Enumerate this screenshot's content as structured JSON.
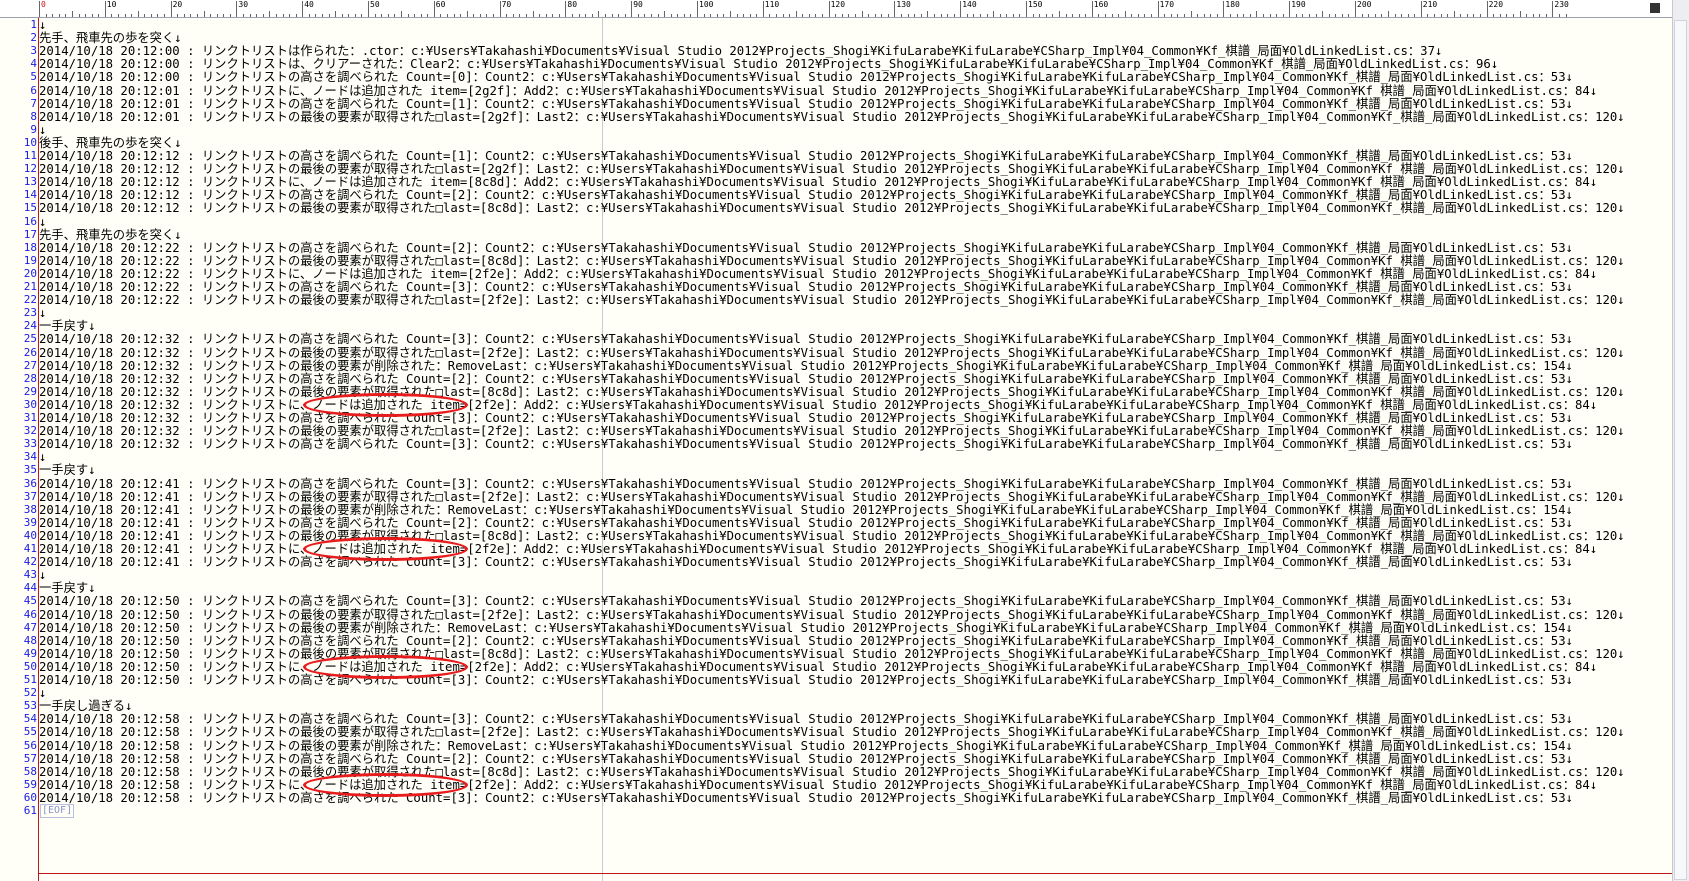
{
  "ruler_end_icon": "ruler-end-marker-icon",
  "ruler_labels": [
    "0",
    "10",
    "20",
    "30",
    "40",
    "50",
    "60",
    "70",
    "80",
    "90",
    "100",
    "110",
    "120",
    "130",
    "140",
    "150",
    "160",
    "170",
    "180",
    "190",
    "200",
    "210",
    "220",
    "230"
  ],
  "eof_marker": "[EOF]",
  "highlight_color": "#e81c1c",
  "line_number_color": "#1a1ae6",
  "highlighted_lines": [
    30,
    41,
    50,
    59
  ],
  "lines": [
    "↓",
    "先手、飛車先の歩を突く↓",
    "2014/10/18 20:12:00 : リンクトリストは作られた：.ctor：c:¥Users¥Takahashi¥Documents¥Visual Studio 2012¥Projects_Shogi¥KifuLarabe¥KifuLarabe¥CSharp_Impl¥04_Common¥Kf_棋譜_局面¥OldLinkedList.cs：37↓",
    "2014/10/18 20:12:00 : リンクトリストは、クリアーされた：Clear2：c:¥Users¥Takahashi¥Documents¥Visual Studio 2012¥Projects_Shogi¥KifuLarabe¥KifuLarabe¥CSharp_Impl¥04_Common¥Kf_棋譜_局面¥OldLinkedList.cs：96↓",
    "2014/10/18 20:12:00 : リンクトリストの高さを調べられた Count=[0]：Count2：c:¥Users¥Takahashi¥Documents¥Visual Studio 2012¥Projects_Shogi¥KifuLarabe¥KifuLarabe¥CSharp_Impl¥04_Common¥Kf_棋譜_局面¥OldLinkedList.cs：53↓",
    "2014/10/18 20:12:01 : リンクトリストに、ノードは追加された item=[2g2f]：Add2：c:¥Users¥Takahashi¥Documents¥Visual Studio 2012¥Projects_Shogi¥KifuLarabe¥KifuLarabe¥CSharp_Impl¥04_Common¥Kf_棋譜_局面¥OldLinkedList.cs：84↓",
    "2014/10/18 20:12:01 : リンクトリストの高さを調べられた Count=[1]：Count2：c:¥Users¥Takahashi¥Documents¥Visual Studio 2012¥Projects_Shogi¥KifuLarabe¥KifuLarabe¥CSharp_Impl¥04_Common¥Kf_棋譜_局面¥OldLinkedList.cs：53↓",
    "2014/10/18 20:12:01 : リンクトリストの最後の要素が取得された□last=[2g2f]：Last2：c:¥Users¥Takahashi¥Documents¥Visual Studio 2012¥Projects_Shogi¥KifuLarabe¥KifuLarabe¥CSharp_Impl¥04_Common¥Kf_棋譜_局面¥OldLinkedList.cs：120↓",
    "↓",
    "後手、飛車先の歩を突く↓",
    "2014/10/18 20:12:12 : リンクトリストの高さを調べられた Count=[1]：Count2：c:¥Users¥Takahashi¥Documents¥Visual Studio 2012¥Projects_Shogi¥KifuLarabe¥KifuLarabe¥CSharp_Impl¥04_Common¥Kf_棋譜_局面¥OldLinkedList.cs：53↓",
    "2014/10/18 20:12:12 : リンクトリストの最後の要素が取得された□last=[2g2f]：Last2：c:¥Users¥Takahashi¥Documents¥Visual Studio 2012¥Projects_Shogi¥KifuLarabe¥KifuLarabe¥CSharp_Impl¥04_Common¥Kf_棋譜_局面¥OldLinkedList.cs：120↓",
    "2014/10/18 20:12:12 : リンクトリストに、ノードは追加された item=[8c8d]：Add2：c:¥Users¥Takahashi¥Documents¥Visual Studio 2012¥Projects_Shogi¥KifuLarabe¥KifuLarabe¥CSharp_Impl¥04_Common¥Kf_棋譜_局面¥OldLinkedList.cs：84↓",
    "2014/10/18 20:12:12 : リンクトリストの高さを調べられた Count=[2]：Count2：c:¥Users¥Takahashi¥Documents¥Visual Studio 2012¥Projects_Shogi¥KifuLarabe¥KifuLarabe¥CSharp_Impl¥04_Common¥Kf_棋譜_局面¥OldLinkedList.cs：53↓",
    "2014/10/18 20:12:12 : リンクトリストの最後の要素が取得された□last=[8c8d]：Last2：c:¥Users¥Takahashi¥Documents¥Visual Studio 2012¥Projects_Shogi¥KifuLarabe¥KifuLarabe¥CSharp_Impl¥04_Common¥Kf_棋譜_局面¥OldLinkedList.cs：120↓",
    "↓",
    "先手、飛車先の歩を突く↓",
    "2014/10/18 20:12:22 : リンクトリストの高さを調べられた Count=[2]：Count2：c:¥Users¥Takahashi¥Documents¥Visual Studio 2012¥Projects_Shogi¥KifuLarabe¥KifuLarabe¥CSharp_Impl¥04_Common¥Kf_棋譜_局面¥OldLinkedList.cs：53↓",
    "2014/10/18 20:12:22 : リンクトリストの最後の要素が取得された□last=[8c8d]：Last2：c:¥Users¥Takahashi¥Documents¥Visual Studio 2012¥Projects_Shogi¥KifuLarabe¥KifuLarabe¥CSharp_Impl¥04_Common¥Kf_棋譜_局面¥OldLinkedList.cs：120↓",
    "2014/10/18 20:12:22 : リンクトリストに、ノードは追加された item=[2f2e]：Add2：c:¥Users¥Takahashi¥Documents¥Visual Studio 2012¥Projects_Shogi¥KifuLarabe¥KifuLarabe¥CSharp_Impl¥04_Common¥Kf_棋譜_局面¥OldLinkedList.cs：84↓",
    "2014/10/18 20:12:22 : リンクトリストの高さを調べられた Count=[3]：Count2：c:¥Users¥Takahashi¥Documents¥Visual Studio 2012¥Projects_Shogi¥KifuLarabe¥KifuLarabe¥CSharp_Impl¥04_Common¥Kf_棋譜_局面¥OldLinkedList.cs：53↓",
    "2014/10/18 20:12:22 : リンクトリストの最後の要素が取得された□last=[2f2e]：Last2：c:¥Users¥Takahashi¥Documents¥Visual Studio 2012¥Projects_Shogi¥KifuLarabe¥KifuLarabe¥CSharp_Impl¥04_Common¥Kf_棋譜_局面¥OldLinkedList.cs：120↓",
    "↓",
    "一手戻す↓",
    "2014/10/18 20:12:32 : リンクトリストの高さを調べられた Count=[3]：Count2：c:¥Users¥Takahashi¥Documents¥Visual Studio 2012¥Projects_Shogi¥KifuLarabe¥KifuLarabe¥CSharp_Impl¥04_Common¥Kf_棋譜_局面¥OldLinkedList.cs：53↓",
    "2014/10/18 20:12:32 : リンクトリストの最後の要素が取得された□last=[2f2e]：Last2：c:¥Users¥Takahashi¥Documents¥Visual Studio 2012¥Projects_Shogi¥KifuLarabe¥KifuLarabe¥CSharp_Impl¥04_Common¥Kf_棋譜_局面¥OldLinkedList.cs：120↓",
    "2014/10/18 20:12:32 : リンクトリストの最後の要素が削除された：RemoveLast：c:¥Users¥Takahashi¥Documents¥Visual Studio 2012¥Projects_Shogi¥KifuLarabe¥KifuLarabe¥CSharp_Impl¥04_Common¥Kf_棋譜_局面¥OldLinkedList.cs：154↓",
    "2014/10/18 20:12:32 : リンクトリストの高さを調べられた Count=[2]：Count2：c:¥Users¥Takahashi¥Documents¥Visual Studio 2012¥Projects_Shogi¥KifuLarabe¥KifuLarabe¥CSharp_Impl¥04_Common¥Kf_棋譜_局面¥OldLinkedList.cs：53↓",
    "2014/10/18 20:12:32 : リンクトリストの最後の要素が取得された□last=[8c8d]：Last2：c:¥Users¥Takahashi¥Documents¥Visual Studio 2012¥Projects_Shogi¥KifuLarabe¥KifuLarabe¥CSharp_Impl¥04_Common¥Kf_棋譜_局面¥OldLinkedList.cs：120↓",
    "2014/10/18 20:12:32 : リンクトリストに、ノードは追加された item=[2f2e]：Add2：c:¥Users¥Takahashi¥Documents¥Visual Studio 2012¥Projects_Shogi¥KifuLarabe¥KifuLarabe¥CSharp_Impl¥04_Common¥Kf_棋譜_局面¥OldLinkedList.cs：84↓",
    "2014/10/18 20:12:32 : リンクトリストの高さを調べられた Count=[3]：Count2：c:¥Users¥Takahashi¥Documents¥Visual Studio 2012¥Projects_Shogi¥KifuLarabe¥KifuLarabe¥CSharp_Impl¥04_Common¥Kf_棋譜_局面¥OldLinkedList.cs：53↓",
    "2014/10/18 20:12:32 : リンクトリストの最後の要素が取得された□last=[2f2e]：Last2：c:¥Users¥Takahashi¥Documents¥Visual Studio 2012¥Projects_Shogi¥KifuLarabe¥KifuLarabe¥CSharp_Impl¥04_Common¥Kf_棋譜_局面¥OldLinkedList.cs：120↓",
    "2014/10/18 20:12:32 : リンクトリストの高さを調べられた Count=[3]：Count2：c:¥Users¥Takahashi¥Documents¥Visual Studio 2012¥Projects_Shogi¥KifuLarabe¥KifuLarabe¥CSharp_Impl¥04_Common¥Kf_棋譜_局面¥OldLinkedList.cs：53↓",
    "↓",
    "一手戻す↓",
    "2014/10/18 20:12:41 : リンクトリストの高さを調べられた Count=[3]：Count2：c:¥Users¥Takahashi¥Documents¥Visual Studio 2012¥Projects_Shogi¥KifuLarabe¥KifuLarabe¥CSharp_Impl¥04_Common¥Kf_棋譜_局面¥OldLinkedList.cs：53↓",
    "2014/10/18 20:12:41 : リンクトリストの最後の要素が取得された□last=[2f2e]：Last2：c:¥Users¥Takahashi¥Documents¥Visual Studio 2012¥Projects_Shogi¥KifuLarabe¥KifuLarabe¥CSharp_Impl¥04_Common¥Kf_棋譜_局面¥OldLinkedList.cs：120↓",
    "2014/10/18 20:12:41 : リンクトリストの最後の要素が削除された：RemoveLast：c:¥Users¥Takahashi¥Documents¥Visual Studio 2012¥Projects_Shogi¥KifuLarabe¥KifuLarabe¥CSharp_Impl¥04_Common¥Kf_棋譜_局面¥OldLinkedList.cs：154↓",
    "2014/10/18 20:12:41 : リンクトリストの高さを調べられた Count=[2]：Count2：c:¥Users¥Takahashi¥Documents¥Visual Studio 2012¥Projects_Shogi¥KifuLarabe¥KifuLarabe¥CSharp_Impl¥04_Common¥Kf_棋譜_局面¥OldLinkedList.cs：53↓",
    "2014/10/18 20:12:41 : リンクトリストの最後の要素が取得された□last=[8c8d]：Last2：c:¥Users¥Takahashi¥Documents¥Visual Studio 2012¥Projects_Shogi¥KifuLarabe¥KifuLarabe¥CSharp_Impl¥04_Common¥Kf_棋譜_局面¥OldLinkedList.cs：120↓",
    "2014/10/18 20:12:41 : リンクトリストに、ノードは追加された item=[2f2e]：Add2：c:¥Users¥Takahashi¥Documents¥Visual Studio 2012¥Projects_Shogi¥KifuLarabe¥KifuLarabe¥CSharp_Impl¥04_Common¥Kf_棋譜_局面¥OldLinkedList.cs：84↓",
    "2014/10/18 20:12:41 : リンクトリストの高さを調べられた Count=[3]：Count2：c:¥Users¥Takahashi¥Documents¥Visual Studio 2012¥Projects_Shogi¥KifuLarabe¥KifuLarabe¥CSharp_Impl¥04_Common¥Kf_棋譜_局面¥OldLinkedList.cs：53↓",
    "↓",
    "一手戻す↓",
    "2014/10/18 20:12:50 : リンクトリストの高さを調べられた Count=[3]：Count2：c:¥Users¥Takahashi¥Documents¥Visual Studio 2012¥Projects_Shogi¥KifuLarabe¥KifuLarabe¥CSharp_Impl¥04_Common¥Kf_棋譜_局面¥OldLinkedList.cs：53↓",
    "2014/10/18 20:12:50 : リンクトリストの最後の要素が取得された□last=[2f2e]：Last2：c:¥Users¥Takahashi¥Documents¥Visual Studio 2012¥Projects_Shogi¥KifuLarabe¥KifuLarabe¥CSharp_Impl¥04_Common¥Kf_棋譜_局面¥OldLinkedList.cs：120↓",
    "2014/10/18 20:12:50 : リンクトリストの最後の要素が削除された：RemoveLast：c:¥Users¥Takahashi¥Documents¥Visual Studio 2012¥Projects_Shogi¥KifuLarabe¥KifuLarabe¥CSharp_Impl¥04_Common¥Kf_棋譜_局面¥OldLinkedList.cs：154↓",
    "2014/10/18 20:12:50 : リンクトリストの高さを調べられた Count=[2]：Count2：c:¥Users¥Takahashi¥Documents¥Visual Studio 2012¥Projects_Shogi¥KifuLarabe¥KifuLarabe¥CSharp_Impl¥04_Common¥Kf_棋譜_局面¥OldLinkedList.cs：53↓",
    "2014/10/18 20:12:50 : リンクトリストの最後の要素が取得された□last=[8c8d]：Last2：c:¥Users¥Takahashi¥Documents¥Visual Studio 2012¥Projects_Shogi¥KifuLarabe¥KifuLarabe¥CSharp_Impl¥04_Common¥Kf_棋譜_局面¥OldLinkedList.cs：120↓",
    "2014/10/18 20:12:50 : リンクトリストに、ノードは追加された item=[2f2e]：Add2：c:¥Users¥Takahashi¥Documents¥Visual Studio 2012¥Projects_Shogi¥KifuLarabe¥KifuLarabe¥CSharp_Impl¥04_Common¥Kf_棋譜_局面¥OldLinkedList.cs：84↓",
    "2014/10/18 20:12:50 : リンクトリストの高さを調べられた Count=[3]：Count2：c:¥Users¥Takahashi¥Documents¥Visual Studio 2012¥Projects_Shogi¥KifuLarabe¥KifuLarabe¥CSharp_Impl¥04_Common¥Kf_棋譜_局面¥OldLinkedList.cs：53↓",
    "↓",
    "一手戻し過ぎる↓",
    "2014/10/18 20:12:58 : リンクトリストの高さを調べられた Count=[3]：Count2：c:¥Users¥Takahashi¥Documents¥Visual Studio 2012¥Projects_Shogi¥KifuLarabe¥KifuLarabe¥CSharp_Impl¥04_Common¥Kf_棋譜_局面¥OldLinkedList.cs：53↓",
    "2014/10/18 20:12:58 : リンクトリストの最後の要素が取得された□last=[2f2e]：Last2：c:¥Users¥Takahashi¥Documents¥Visual Studio 2012¥Projects_Shogi¥KifuLarabe¥KifuLarabe¥CSharp_Impl¥04_Common¥Kf_棋譜_局面¥OldLinkedList.cs：120↓",
    "2014/10/18 20:12:58 : リンクトリストの最後の要素が削除された：RemoveLast：c:¥Users¥Takahashi¥Documents¥Visual Studio 2012¥Projects_Shogi¥KifuLarabe¥KifuLarabe¥CSharp_Impl¥04_Common¥Kf_棋譜_局面¥OldLinkedList.cs：154↓",
    "2014/10/18 20:12:58 : リンクトリストの高さを調べられた Count=[2]：Count2：c:¥Users¥Takahashi¥Documents¥Visual Studio 2012¥Projects_Shogi¥KifuLarabe¥KifuLarabe¥CSharp_Impl¥04_Common¥Kf_棋譜_局面¥OldLinkedList.cs：53↓",
    "2014/10/18 20:12:58 : リンクトリストの最後の要素が取得された□last=[8c8d]：Last2：c:¥Users¥Takahashi¥Documents¥Visual Studio 2012¥Projects_Shogi¥KifuLarabe¥KifuLarabe¥CSharp_Impl¥04_Common¥Kf_棋譜_局面¥OldLinkedList.cs：120↓",
    "2014/10/18 20:12:58 : リンクトリストに、ノードは追加された item=[2f2e]：Add2：c:¥Users¥Takahashi¥Documents¥Visual Studio 2012¥Projects_Shogi¥KifuLarabe¥KifuLarabe¥CSharp_Impl¥04_Common¥Kf_棋譜_局面¥OldLinkedList.cs：84↓",
    "2014/10/18 20:12:58 : リンクトリストの高さを調べられた Count=[3]：Count2：c:¥Users¥Takahashi¥Documents¥Visual Studio 2012¥Projects_Shogi¥KifuLarabe¥KifuLarabe¥CSharp_Impl¥04_Common¥Kf_棋譜_局面¥OldLinkedList.cs：53↓"
  ]
}
